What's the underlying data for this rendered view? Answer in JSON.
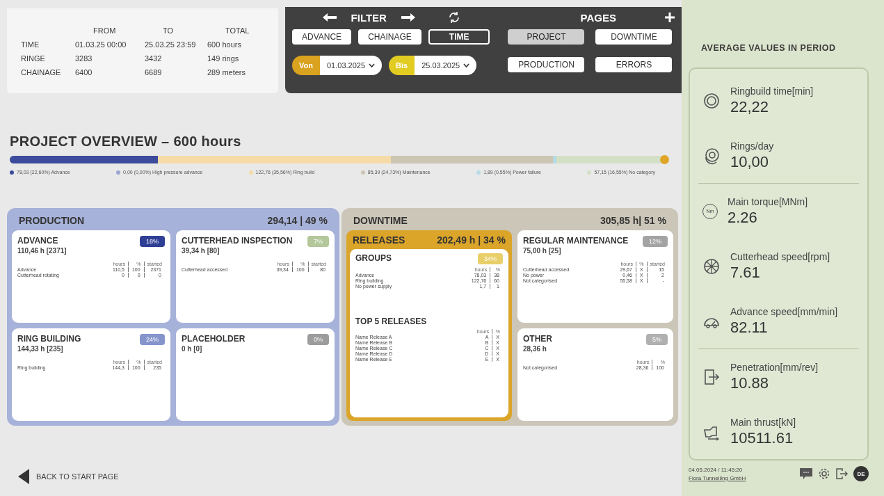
{
  "summary": {
    "columns": [
      "FROM",
      "TO",
      "TOTAL"
    ],
    "rows": [
      {
        "label": "TIME",
        "values": [
          "01.03.25 00:00",
          "25.03.25 23:59",
          "600 hours"
        ]
      },
      {
        "label": "RINGE",
        "values": [
          "3283",
          "3432",
          "149 rings"
        ]
      },
      {
        "label": "CHAINAGE",
        "values": [
          "6400",
          "6689",
          "289 meters"
        ]
      }
    ]
  },
  "filter": {
    "title": "FILTER",
    "tabs": [
      {
        "label": "ADVANCE",
        "selected": false
      },
      {
        "label": "CHAINAGE",
        "selected": false
      },
      {
        "label": "TIME",
        "selected": true
      }
    ],
    "dates": [
      {
        "tag": "Von",
        "value": "01.03.2025",
        "color": "#d9a21f"
      },
      {
        "tag": "Bis",
        "value": "25.03.2025",
        "color": "#e3cc22"
      }
    ]
  },
  "pages": {
    "title": "PAGES",
    "items": [
      {
        "label": "PROJECT",
        "selected": true
      },
      {
        "label": "DOWNTIME",
        "selected": false
      },
      {
        "label": "PRODUCTION",
        "selected": false
      },
      {
        "label": "ERRORS",
        "selected": false
      }
    ]
  },
  "overview": {
    "title": "PROJECT OVERVIEW – 600 hours",
    "segments": [
      {
        "legend": "78,03 (22,60%) Advance",
        "color": "#3d4b9c"
      },
      {
        "legend": "0,00 (0,00%) High pressure advance",
        "color": "#9aa6cf"
      },
      {
        "legend": "122,76 (35,56%) Ring build",
        "color": "#f6dba8"
      },
      {
        "legend": "85,39 (24,73%) Maintenance",
        "color": "#cdc5b3"
      },
      {
        "legend": "1,89 (0,55%) Power failure",
        "color": "#b5dbe6"
      },
      {
        "legend": "57,15 (16,55%) No category",
        "color": "#d3e0c6"
      }
    ]
  },
  "production": {
    "title": "PRODUCTION",
    "total": "294,14 | 49 %",
    "cards": [
      {
        "title": "ADVANCE",
        "subtitle": "110,46 h [2371]",
        "badge": {
          "text": "18%",
          "color": "#2f3f96"
        },
        "table": {
          "columns": [
            "hours",
            "%",
            "started"
          ],
          "rows": [
            {
              "label": "Advance",
              "values": [
                "110,5",
                "100",
                "2371"
              ]
            },
            {
              "label": "Cutterhead rotating",
              "values": [
                "0",
                "0",
                "0"
              ]
            }
          ]
        }
      },
      {
        "title": "CUTTERHEAD INSPECTION",
        "subtitle": "39,34 h [80]",
        "badge": {
          "text": "7%",
          "color": "#b3c79a"
        },
        "table": {
          "columns": [
            "hours",
            "%",
            "started"
          ],
          "rows": [
            {
              "label": "Cutterhead accessed",
              "values": [
                "39,34",
                "100",
                "80"
              ]
            }
          ]
        }
      },
      {
        "title": "RING BUILDING",
        "subtitle": "144,33 h [235]",
        "badge": {
          "text": "24%",
          "color": "#8595cc"
        },
        "table": {
          "columns": [
            "hours",
            "%",
            "started"
          ],
          "rows": [
            {
              "label": "Ring building",
              "values": [
                "144,3",
                "100",
                "235"
              ]
            }
          ]
        }
      },
      {
        "title": "PLACEHOLDER",
        "subtitle": "0 h [0]",
        "badge": {
          "text": "0%",
          "color": "#9c9c9c"
        }
      }
    ]
  },
  "downtime": {
    "title": "DOWNTIME",
    "total": "305,85 h| 51 %",
    "releases": {
      "title": "RELEASES",
      "total": "202,49 h | 34 %",
      "sections": [
        {
          "title": "GROUPS",
          "badge": {
            "text": "34%",
            "color": "#e9cf6a"
          },
          "table": {
            "columns": [
              "hours",
              "%"
            ],
            "rows": [
              {
                "label": "Advance",
                "values": [
                  "78,03",
                  "38"
                ]
              },
              {
                "label": "Ring building",
                "values": [
                  "122,76",
                  "60"
                ]
              },
              {
                "label": "No power supply",
                "values": [
                  "1,7",
                  "1"
                ]
              }
            ]
          }
        },
        {
          "title": "TOP 5 RELEASES",
          "table": {
            "columns": [
              "hours",
              "%"
            ],
            "rows": [
              {
                "label": "Name Release A",
                "values": [
                  "A",
                  "X"
                ]
              },
              {
                "label": "Name Release B",
                "values": [
                  "B",
                  "X"
                ]
              },
              {
                "label": "Name Release C",
                "values": [
                  "C",
                  "X"
                ]
              },
              {
                "label": "Name Release D",
                "values": [
                  "D",
                  "X"
                ]
              },
              {
                "label": "Name Release E",
                "values": [
                  "E",
                  "X"
                ]
              }
            ]
          }
        }
      ]
    },
    "cards": [
      {
        "title": "REGULAR MAINTENANCE",
        "subtitle": "75,00 h [25]",
        "badge": {
          "text": "12%",
          "color": "#a3a3a3"
        },
        "table": {
          "columns": [
            "hours",
            "%",
            "started"
          ],
          "rows": [
            {
              "label": "Cutterhead accessed",
              "values": [
                "29,67",
                "X",
                "15"
              ]
            },
            {
              "label": "No power",
              "values": [
                "0,46",
                "X",
                "2"
              ]
            },
            {
              "label": "Not categorised",
              "values": [
                "55,58",
                "X",
                "-"
              ]
            }
          ]
        }
      },
      {
        "title": "OTHER",
        "subtitle": "28,36 h",
        "badge": {
          "text": "5%",
          "color": "#b0b0b0"
        },
        "table": {
          "columns": [
            "hours",
            "%"
          ],
          "rows": [
            {
              "label": "Not categorised",
              "values": [
                "28,36",
                "100"
              ]
            }
          ]
        }
      }
    ]
  },
  "back": "BACK TO START PAGE",
  "averages": {
    "title": "AVERAGE VALUES IN PERIOD",
    "groups": [
      {
        "metrics": [
          {
            "label": "Ringbuild time[min]",
            "value": "22,22"
          },
          {
            "label": "Rings/day",
            "value": "10,00"
          }
        ]
      },
      {
        "metrics": [
          {
            "label": "Main torque[MNm]",
            "value": "2.26",
            "symbol": "Nm"
          },
          {
            "label": "Cutterhead speed[rpm]",
            "value": "7.61"
          },
          {
            "label": "Advance speed[mm/min]",
            "value": "82.11"
          }
        ]
      },
      {
        "metrics": [
          {
            "label": "Penetration[mm/rev]",
            "value": "10.88"
          },
          {
            "label": "Main thrust[kN]",
            "value": "10511.61"
          }
        ]
      }
    ]
  },
  "footer": {
    "timestamp": "04.05.2024 / 11:45:20",
    "company": "Flora Tunnelling GmbH",
    "language": "DE"
  }
}
